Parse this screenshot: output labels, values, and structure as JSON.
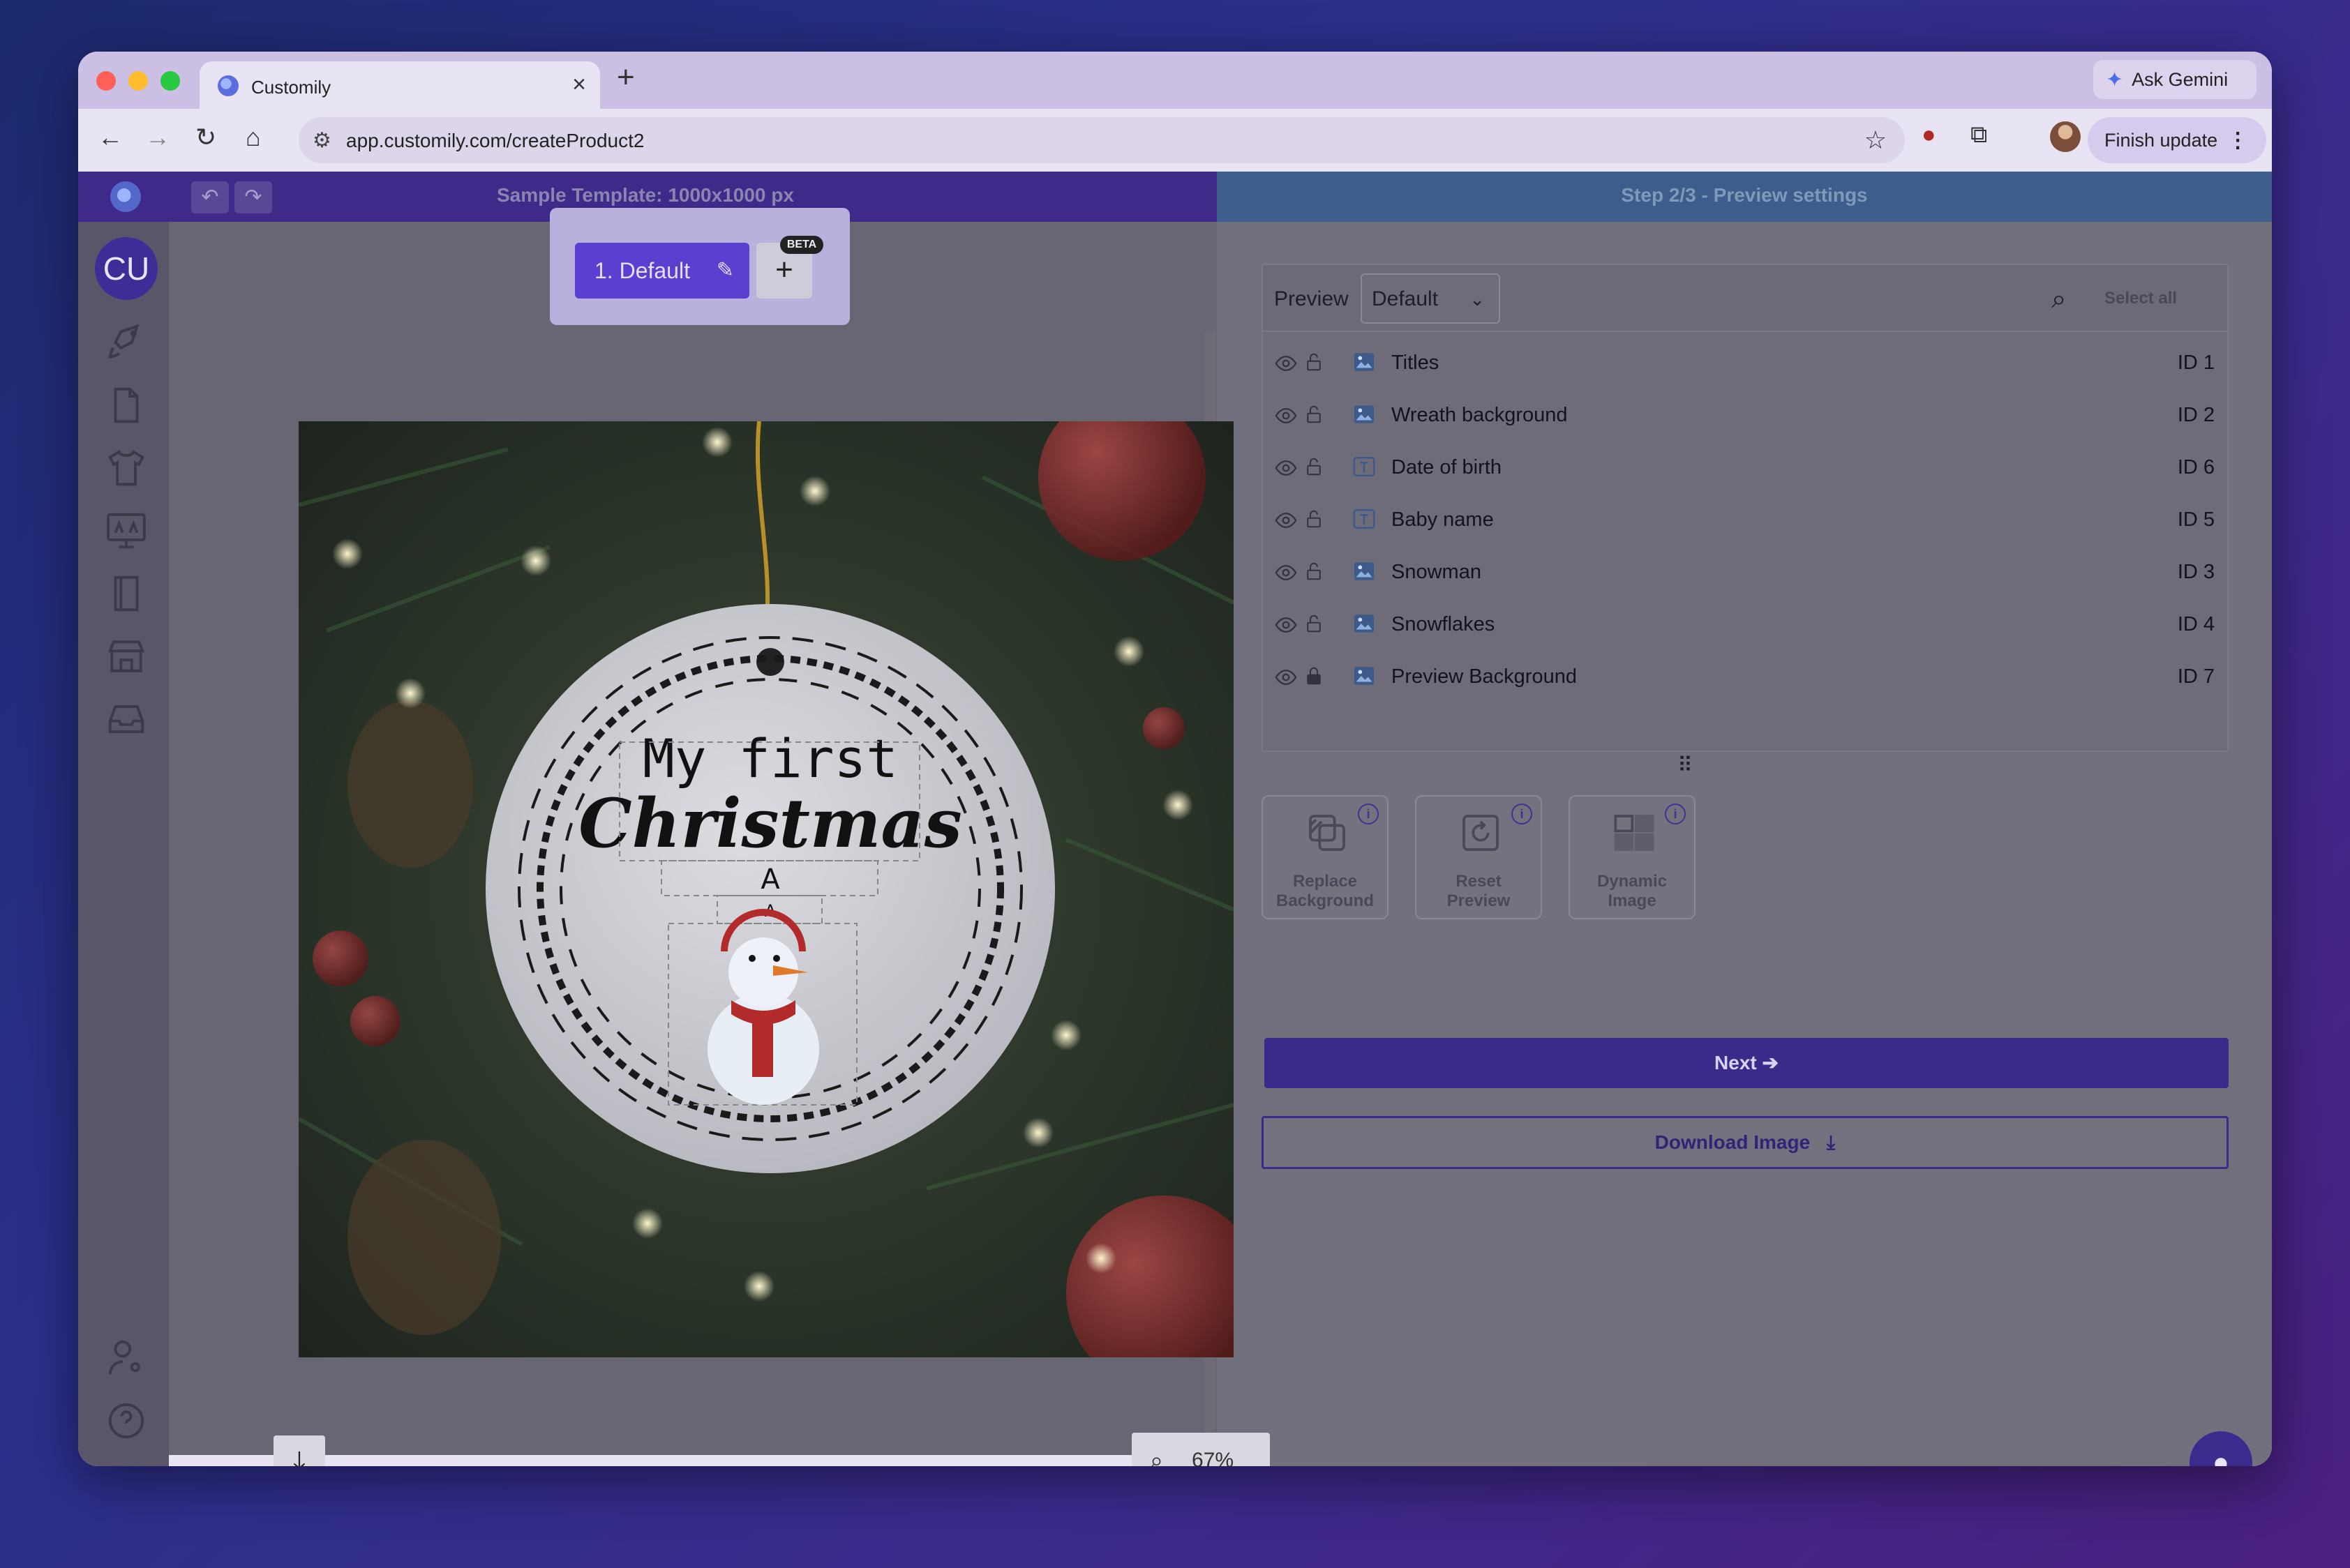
{
  "browser": {
    "tab_title": "Customily",
    "tab_close": "×",
    "new_tab": "+",
    "ask_gemini": "Ask Gemini",
    "url": "app.customily.com/createProduct2",
    "finish_update": "Finish update"
  },
  "app": {
    "template_title": "Sample Template: 1000x1000 px",
    "step_title": "Step 2/3 - Preview settings",
    "avatar_initials": "CU",
    "variant": {
      "label": "1. Default",
      "beta": "BETA",
      "add": "+"
    },
    "zoom": "67%",
    "colors": {
      "accent": "#3c2a8a",
      "variant_button": "#5a3fd0"
    }
  },
  "preview": {
    "label": "Preview",
    "selected": "Default",
    "select_all": "Select all"
  },
  "layers": [
    {
      "name": "Titles",
      "id": "ID 1",
      "type": "image-icon",
      "locked": false
    },
    {
      "name": "Wreath background",
      "id": "ID 2",
      "type": "image-icon",
      "locked": false
    },
    {
      "name": "Date of birth",
      "id": "ID 6",
      "type": "text-icon",
      "locked": false
    },
    {
      "name": "Baby name",
      "id": "ID 5",
      "type": "text-icon",
      "locked": false
    },
    {
      "name": "Snowman",
      "id": "ID 3",
      "type": "image-icon",
      "locked": false
    },
    {
      "name": "Snowflakes",
      "id": "ID 4",
      "type": "image-icon",
      "locked": false
    },
    {
      "name": "Preview Background",
      "id": "ID 7",
      "type": "image-icon",
      "locked": true
    }
  ],
  "tools": [
    {
      "label_line1": "Replace",
      "label_line2": "Background",
      "icon": "replace-background-icon"
    },
    {
      "label_line1": "Reset",
      "label_line2": "Preview",
      "icon": "reset-preview-icon"
    },
    {
      "label_line1": "Dynamic",
      "label_line2": "Image",
      "icon": "dynamic-image-icon"
    }
  ],
  "actions": {
    "next": "Next ➔",
    "download": "Download Image"
  },
  "ornament": {
    "line1": "My first",
    "line2": "Christmas",
    "initial_big": "A",
    "initial_small": "A"
  }
}
